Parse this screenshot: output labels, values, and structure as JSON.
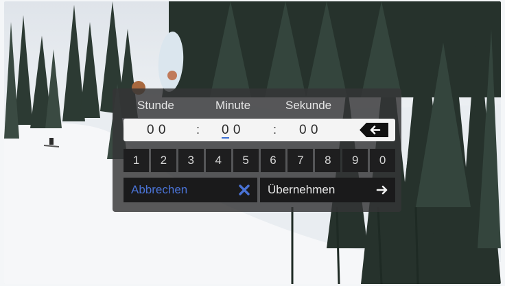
{
  "dialog": {
    "labels": {
      "hour": "Stunde",
      "minute": "Minute",
      "second": "Sekunde"
    },
    "time": {
      "hours": "0 0",
      "minutes_first": "0",
      "minutes_second": "0",
      "seconds": "0 0",
      "separator": ":"
    },
    "keypad": [
      "1",
      "2",
      "3",
      "4",
      "5",
      "6",
      "7",
      "8",
      "9",
      "0"
    ],
    "cancel_label": "Abbrechen",
    "apply_label": "Übernehmen",
    "icons": {
      "backspace": "backspace-icon",
      "cancel": "close-icon",
      "apply": "arrow-right-icon"
    },
    "colors": {
      "accent": "#4a73d6",
      "panel": "#343436"
    }
  }
}
